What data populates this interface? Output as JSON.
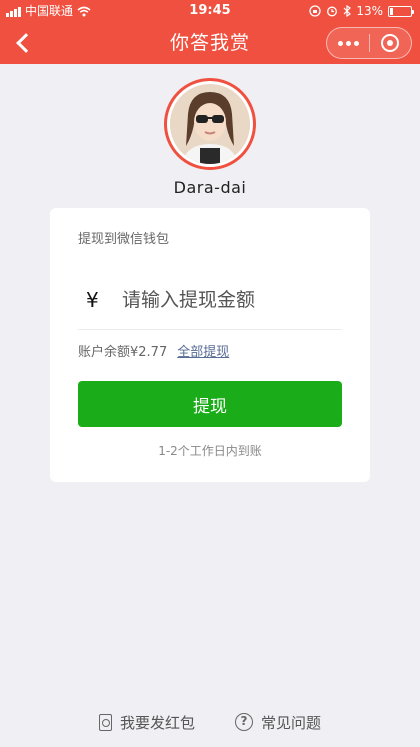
{
  "status_bar": {
    "carrier": "中国联通",
    "time": "19:45",
    "battery": "13%"
  },
  "nav": {
    "title": "你答我赏"
  },
  "profile": {
    "name": "Dara-dai"
  },
  "withdraw": {
    "label": "提现到微信钱包",
    "currency": "¥",
    "amount_placeholder": "请输入提现金额",
    "balance_text": "账户余额¥2.77",
    "withdraw_all": "全部提现",
    "button": "提现",
    "arrival_note": "1-2个工作日内到账"
  },
  "footer": {
    "red_packet": "我要发红包",
    "faq": "常见问题"
  },
  "colors": {
    "header": "#f0503f",
    "button": "#1aad19",
    "link": "#576b95",
    "background": "#efeff4"
  }
}
